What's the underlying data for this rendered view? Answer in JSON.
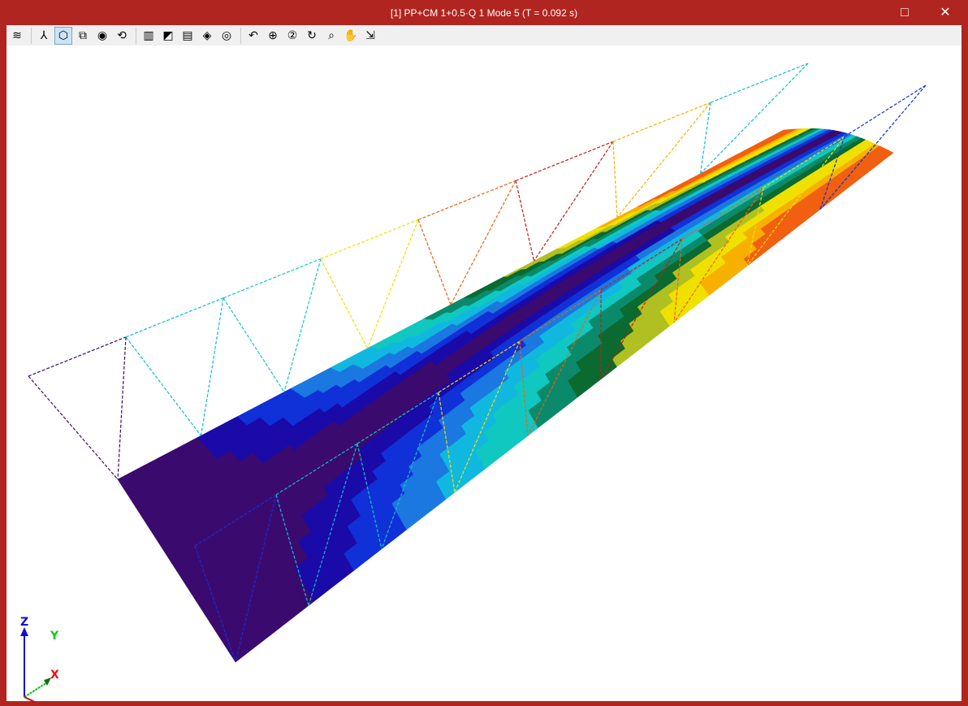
{
  "window": {
    "title": "[1] PP+CM 1+0.5·Q 1 Mode 5 (T = 0.092 s)",
    "maximize_icon": "□",
    "close_icon": "✕"
  },
  "toolbar": [
    {
      "name": "layers-icon",
      "glyph": "≋"
    },
    {
      "sep": true
    },
    {
      "name": "axes-icon",
      "glyph": "⅄"
    },
    {
      "name": "solid-view-icon",
      "glyph": "⬡",
      "active": true
    },
    {
      "name": "wireframe-view-icon",
      "glyph": "⧉"
    },
    {
      "name": "orbit-icon",
      "glyph": "◉"
    },
    {
      "name": "rotate-axis-icon",
      "glyph": "⟲"
    },
    {
      "sep": true
    },
    {
      "name": "section-icon",
      "glyph": "▥"
    },
    {
      "name": "diagonal-cut-icon",
      "glyph": "◩"
    },
    {
      "name": "plane-cut-icon",
      "glyph": "▤"
    },
    {
      "name": "layers-3d-icon",
      "glyph": "◈"
    },
    {
      "name": "hide-icon",
      "glyph": "◎"
    },
    {
      "sep": true
    },
    {
      "name": "zoom-previous-icon",
      "glyph": "↶"
    },
    {
      "name": "zoom-extents-icon",
      "glyph": "⊕"
    },
    {
      "name": "zoom-x2-icon",
      "glyph": "②"
    },
    {
      "name": "redraw-icon",
      "glyph": "↻"
    },
    {
      "name": "zoom-window-icon",
      "glyph": "⌕"
    },
    {
      "name": "pan-icon",
      "glyph": "✋"
    },
    {
      "name": "fit-window-icon",
      "glyph": "⇲"
    }
  ],
  "axes": {
    "z": "Z",
    "y": "Y",
    "x": "X"
  },
  "colormap": [
    "#3b0a6e",
    "#1a0aa8",
    "#1030d8",
    "#1a78e0",
    "#10b8e0",
    "#10c8c0",
    "#0a8a6a",
    "#0a6a30",
    "#b0c020",
    "#f0e000",
    "#f8b000",
    "#f06010"
  ]
}
